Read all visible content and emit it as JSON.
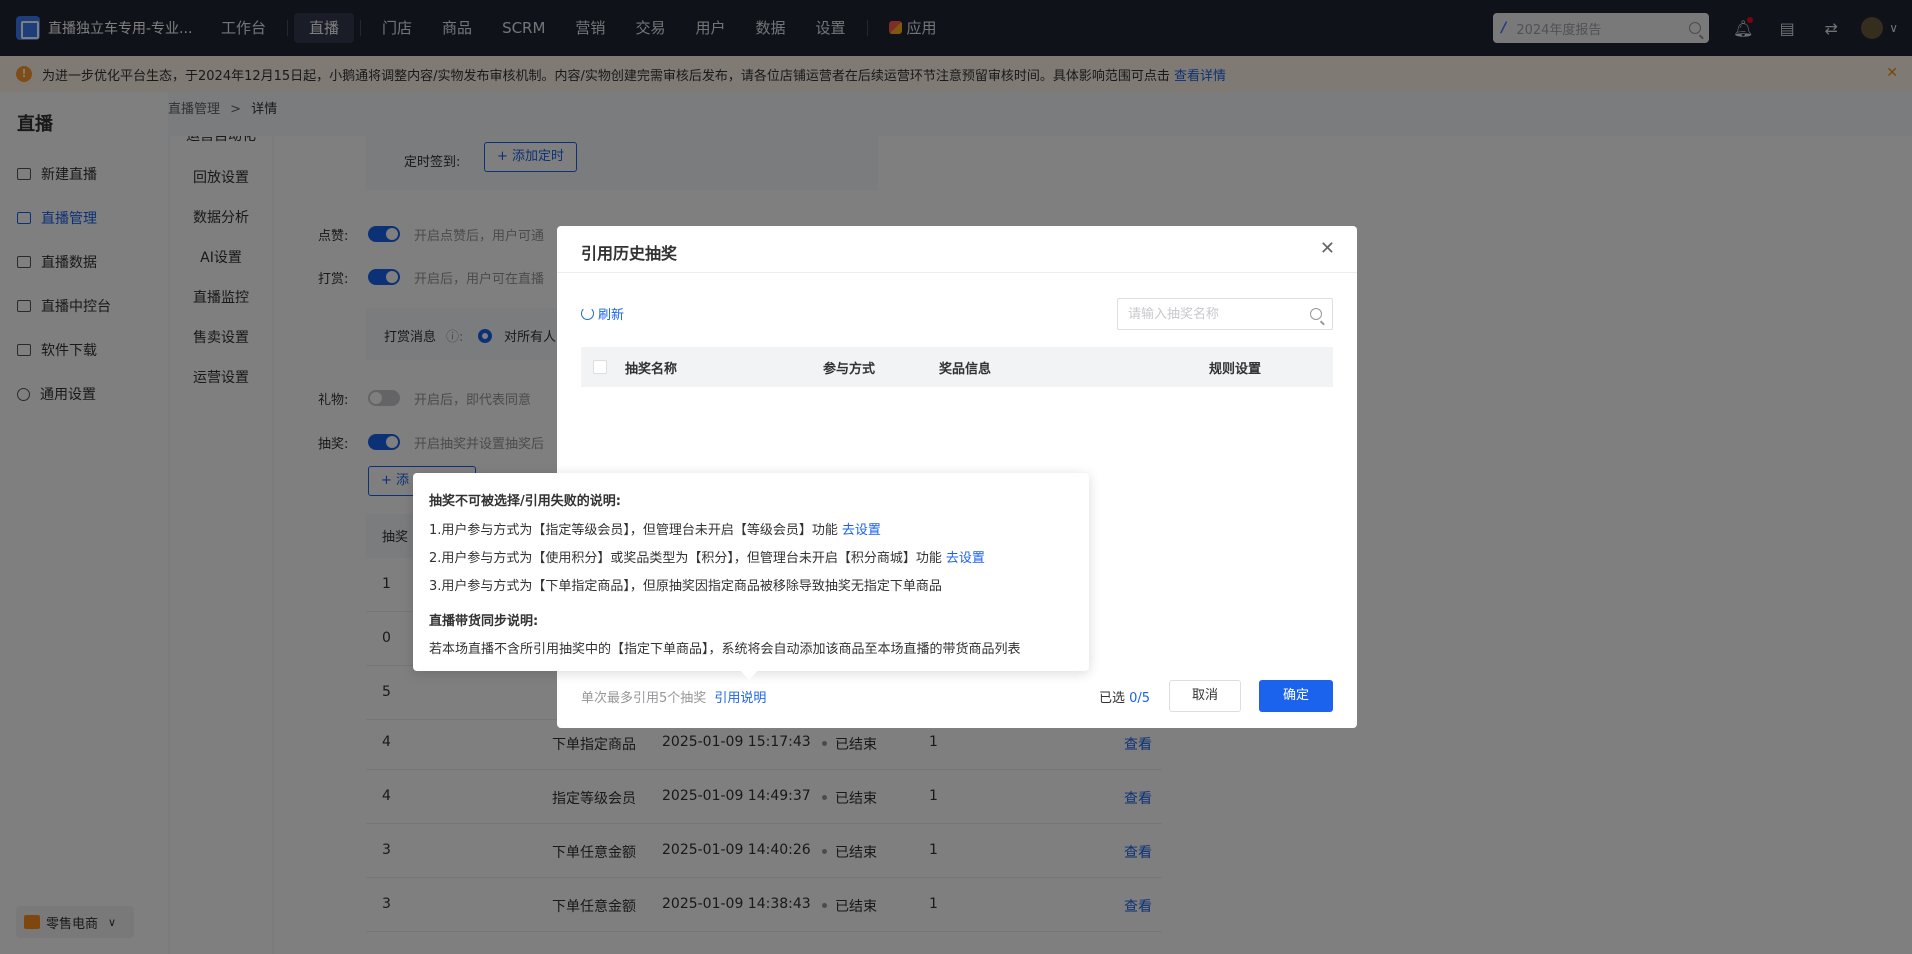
{
  "topbar": {
    "app_name": "直播独立车专用-专业...",
    "nav": [
      "工作台",
      "直播",
      "门店",
      "商品",
      "SCRM",
      "营销",
      "交易",
      "用户",
      "数据",
      "设置",
      "应用"
    ],
    "search_placeholder": "2024年度报告"
  },
  "notice": {
    "text": "为进一步优化平台生态，于2024年12月15日起，小鹅通将调整内容/实物发布审核机制。内容/实物创建完需审核后发布，请各位店铺运营者在后续运营环节注意预留审核时间。具体影响范围可点击",
    "link": "查看详情"
  },
  "sidebar": {
    "title": "直播",
    "items": [
      {
        "label": "新建直播"
      },
      {
        "label": "直播管理"
      },
      {
        "label": "直播数据"
      },
      {
        "label": "直播中控台"
      },
      {
        "label": "软件下载"
      },
      {
        "label": "通用设置"
      }
    ],
    "footer": "零售电商"
  },
  "breadcrumb": {
    "parent": "直播管理",
    "sep": ">",
    "current": "详情"
  },
  "subnav": [
    "运营自动化",
    "回放设置",
    "数据分析",
    "AI设置",
    "直播监控",
    "售卖设置",
    "运营设置"
  ],
  "content": {
    "timed_checkin_label": "定时签到:",
    "add_timer": "+ 添加定时",
    "like_label": "点赞:",
    "like_hint": "开启点赞后，用户可通",
    "reward_label": "打赏:",
    "reward_hint": "开启后，用户可在直播",
    "reward_msg_label": "打赏消息",
    "reward_msg_option": "对所有人",
    "gift_label": "礼物:",
    "gift_hint": "开启后，即代表同意",
    "lottery_label": "抽奖:",
    "lottery_hint": "开启抽奖并设置抽奖后",
    "add_btn": "+ 添",
    "table_col": "抽奖",
    "rows": [
      {
        "c1": "1",
        "way": "",
        "time": "",
        "status": "",
        "n": "",
        "op": ""
      },
      {
        "c1": "0",
        "way": "",
        "time": "",
        "status": "",
        "n": "",
        "op": ""
      },
      {
        "c1": "5",
        "way": "",
        "time": "",
        "status": "",
        "n": "",
        "op": ""
      },
      {
        "c1": "4",
        "way": "下单指定商品",
        "time": "2025-01-09 15:17:43",
        "status": "已结束",
        "n": "1",
        "op": "查看"
      },
      {
        "c1": "4",
        "way": "指定等级会员",
        "time": "2025-01-09 14:49:37",
        "status": "已结束",
        "n": "1",
        "op": "查看"
      },
      {
        "c1": "3",
        "way": "下单任意金额",
        "time": "2025-01-09 14:40:26",
        "status": "已结束",
        "n": "1",
        "op": "查看"
      },
      {
        "c1": "3",
        "way": "下单任意金额",
        "time": "2025-01-09 14:38:43",
        "status": "已结束",
        "n": "1",
        "op": "查看"
      }
    ]
  },
  "modal": {
    "title": "引用历史抽奖",
    "refresh": "刷新",
    "search_placeholder": "请输入抽奖名称",
    "columns": [
      "抽奖名称",
      "参与方式",
      "奖品信息",
      "规则设置"
    ],
    "footer_note": "单次最多引用5个抽奖",
    "footer_link": "引用说明",
    "selected_label": "已选",
    "selected_value": "0/5",
    "cancel": "取消",
    "confirm": "确定"
  },
  "tooltip": {
    "h1": "抽奖不可被选择/引用失败的说明:",
    "l1": "1.用户参与方式为【指定等级会员】，但管理台未开启【等级会员】功能",
    "l1_link": "去设置",
    "l2": "2.用户参与方式为【使用积分】或奖品类型为【积分】，但管理台未开启【积分商城】功能",
    "l2_link": "去设置",
    "l3": "3.用户参与方式为【下单指定商品】，但原抽奖因指定商品被移除导致抽奖无指定下单商品",
    "h2": "直播带货同步说明:",
    "l4": "若本场直播不含所引用抽奖中的【指定下单商品】，系统将会自动添加该商品至本场直播的带货商品列表"
  }
}
